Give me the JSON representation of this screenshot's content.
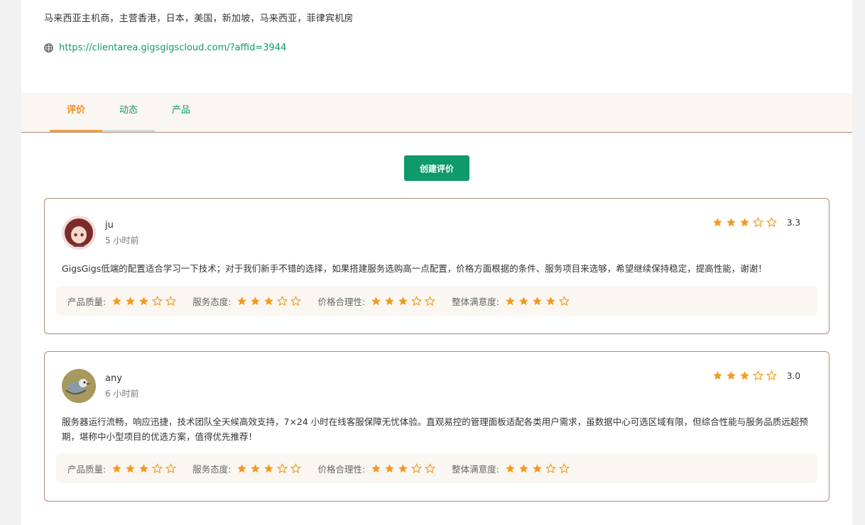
{
  "company": {
    "description": "马来西亚主机商，主营香港，日本，美国，新加坡，马来西亚，菲律宾机房",
    "website": "https://clientarea.gigsgigscloud.com/?affid=3944"
  },
  "tabs": [
    {
      "label": "评价",
      "active": true
    },
    {
      "label": "动态",
      "active": false
    },
    {
      "label": "产品",
      "active": false
    }
  ],
  "create_review_label": "创建评价",
  "colors": {
    "accent_green": "#0e9a6a",
    "star_orange": "#f39a1d",
    "active_tab": "#f08c1e"
  },
  "reviews": [
    {
      "username": "ju",
      "time": "5 小时前",
      "overall_score": "3.3",
      "overall_stars": 3,
      "text": "GigsGigs低端的配置适合学习一下技术；对于我们新手不错的选择，如果搭建服务选购高一点配置，价格方面根据的条件、服务项目来选够，希望继续保持稳定，提高性能，谢谢！",
      "ratings": [
        {
          "label": "产品质量:",
          "stars": 3
        },
        {
          "label": "服务态度:",
          "stars": 3
        },
        {
          "label": "价格合理性:",
          "stars": 3
        },
        {
          "label": "整体满意度:",
          "stars": 4
        }
      ]
    },
    {
      "username": "any",
      "time": "6 小时前",
      "overall_score": "3.0",
      "overall_stars": 3,
      "text": "服务器运行流畅，响应迅捷，技术团队全天候高效支持，7×24 小时在线客服保障无忧体验。直观易控的管理面板适配各类用户需求，虽数据中心可选区域有限，但综合性能与服务品质远超预期，堪称中小型项目的优选方案，值得优先推荐！",
      "ratings": [
        {
          "label": "产品质量:",
          "stars": 3
        },
        {
          "label": "服务态度:",
          "stars": 3
        },
        {
          "label": "价格合理性:",
          "stars": 3
        },
        {
          "label": "整体满意度:",
          "stars": 3
        }
      ]
    }
  ]
}
